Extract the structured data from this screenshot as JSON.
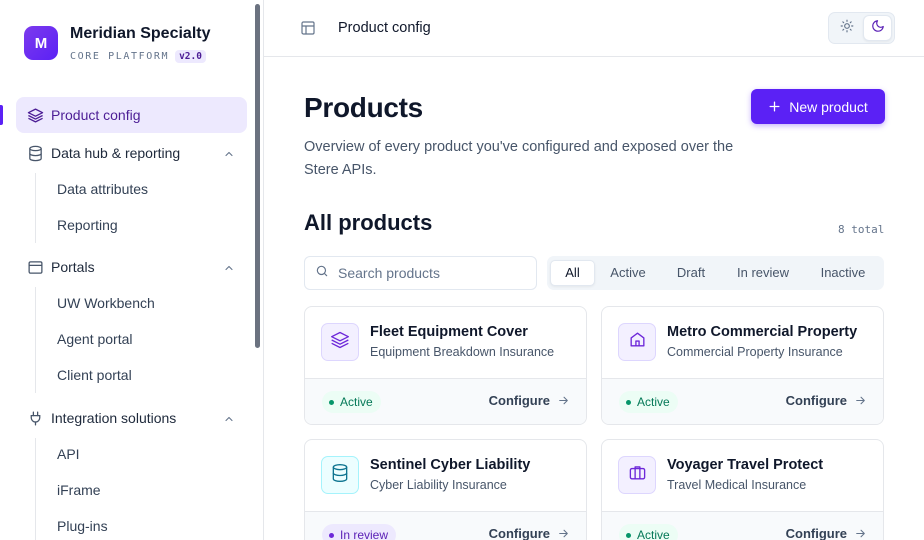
{
  "brand": {
    "initial": "M",
    "name": "Meridian Specialty",
    "platform": "CORE PLATFORM",
    "version": "v2.0"
  },
  "sidebar": {
    "items": [
      {
        "label": "Product config",
        "icon": "layers-icon",
        "active": true
      },
      {
        "label": "Data hub & reporting",
        "icon": "database-icon",
        "expanded": true,
        "children": [
          "Data attributes",
          "Reporting"
        ]
      },
      {
        "label": "Portals",
        "icon": "browser-window-icon",
        "expanded": true,
        "children": [
          "UW Workbench",
          "Agent portal",
          "Client portal"
        ]
      },
      {
        "label": "Integration solutions",
        "icon": "plug-icon",
        "expanded": true,
        "children": [
          "API",
          "iFrame",
          "Plug-ins"
        ]
      }
    ]
  },
  "topbar": {
    "breadcrumb": "Product config"
  },
  "page": {
    "title": "Products",
    "description": "Overview of every product you've configured and exposed over the Stere APIs.",
    "new_button": "New product",
    "section_title": "All products",
    "total": "8 total",
    "search_placeholder": "Search products",
    "filters": [
      "All",
      "Active",
      "Draft",
      "In review",
      "Inactive"
    ],
    "active_filter": "All"
  },
  "cards": [
    {
      "name": "Fleet Equipment Cover",
      "type": "Equipment Breakdown Insurance",
      "status": "Active",
      "icon": "layers-icon",
      "action": "Configure"
    },
    {
      "name": "Metro Commercial Property",
      "type": "Commercial Property Insurance",
      "status": "Active",
      "icon": "building-icon",
      "action": "Configure"
    },
    {
      "name": "Sentinel Cyber Liability",
      "type": "Cyber Liability Insurance",
      "status": "In review",
      "icon": "database-icon",
      "action": "Configure"
    },
    {
      "name": "Voyager Travel Protect",
      "type": "Travel Medical Insurance",
      "status": "Active",
      "icon": "briefcase-icon",
      "action": "Configure"
    }
  ],
  "colors": {
    "accent": "#5b21f5",
    "active_bg": "#ede9fe",
    "success": "#047857",
    "review": "#5b21b6"
  }
}
